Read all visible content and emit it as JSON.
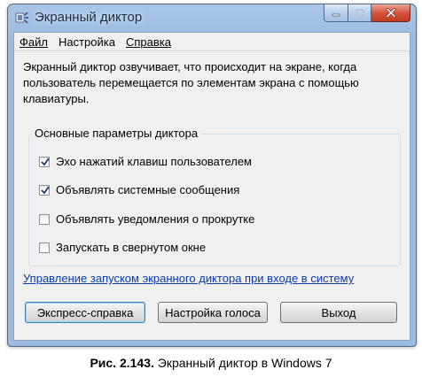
{
  "window": {
    "title": "Экранный диктор"
  },
  "menu": [
    "Файл",
    "Настройка",
    "Справка"
  ],
  "description": "Экранный диктор озвучивает, что происходит на экране, когда пользователь перемещается по элементам экрана с помощью клавиатуры.",
  "group": {
    "title": "Основные параметры диктора",
    "options": [
      {
        "label": "Эхо нажатий клавиш пользователем",
        "checked": true
      },
      {
        "label": "Объявлять системные сообщения",
        "checked": true
      },
      {
        "label": "Объявлять уведомления о прокрутке",
        "checked": false
      },
      {
        "label": "Запускать в свернутом окне",
        "checked": false
      }
    ]
  },
  "link": "Управление запуском экранного диктора при входе в систему",
  "buttons": {
    "quick_help": "Экспресс-справка",
    "voice_settings": "Настройка голоса",
    "exit": "Выход"
  },
  "figure_caption": {
    "number": "Рис. 2.143.",
    "text": " Экранный диктор в Windows 7"
  },
  "colors": {
    "link": "#0a3ab0",
    "close_button": "#d7553f",
    "frame": "#9dbbe0"
  },
  "icons": [
    "narrator-app-icon",
    "minimize-icon",
    "maximize-icon",
    "close-icon",
    "checkmark-icon"
  ]
}
